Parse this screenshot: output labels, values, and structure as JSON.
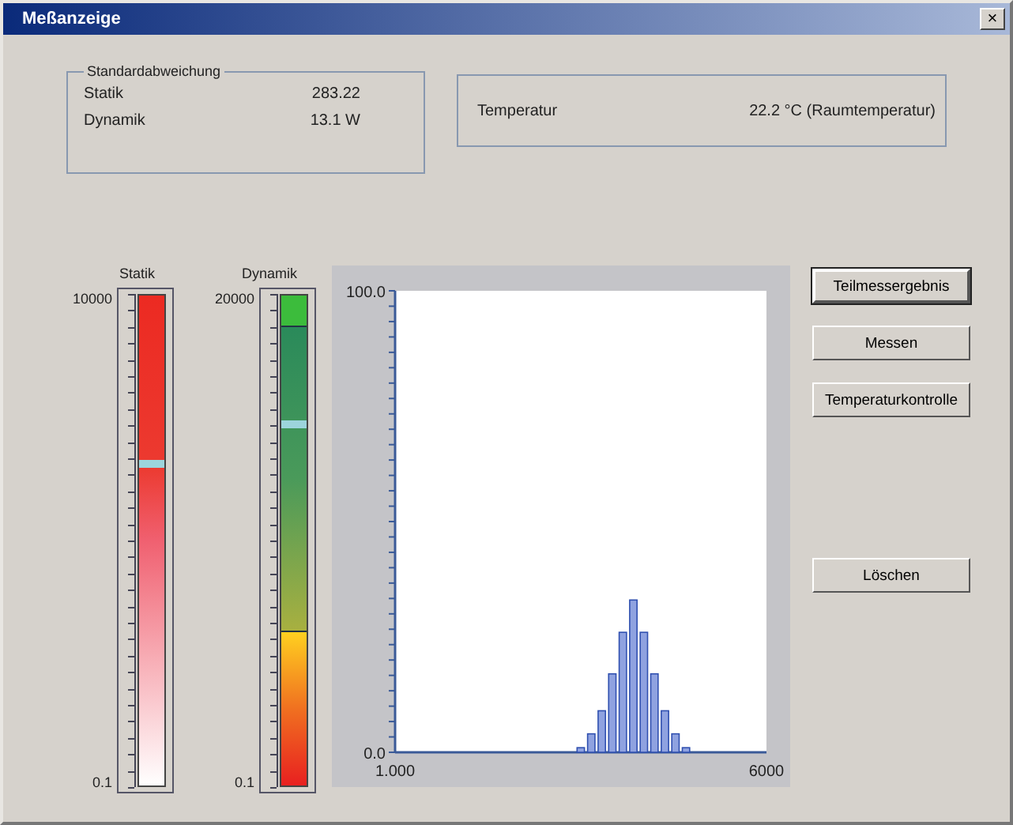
{
  "window": {
    "title": "Meßanzeige",
    "close": "×"
  },
  "standard_group": {
    "title": "Standardabweichung",
    "rows": [
      {
        "label": "Statik",
        "value": "283.22"
      },
      {
        "label": "Dynamik",
        "value": "13.1 W"
      }
    ]
  },
  "temperature": {
    "label": "Temperatur",
    "value": "22.2 °C (Raumtemperatur)"
  },
  "meters": [
    {
      "label": "Statik",
      "kind": "gradient",
      "max": "10000",
      "min": "0.1",
      "level": 0.65
    },
    {
      "label": "Dynamik",
      "kind": "zones",
      "max": "20000",
      "min": "0.1",
      "level": 0.73
    }
  ],
  "histogram": {
    "chart_data": {
      "type": "bar",
      "x": [
        3000,
        3170,
        3340,
        3510,
        3680,
        3850,
        4020,
        4190,
        4360,
        4530,
        4700
      ],
      "values": [
        1,
        4,
        9,
        17,
        26,
        33,
        26,
        17,
        9,
        4,
        1
      ],
      "xlim": [
        1,
        6000
      ],
      "ylim": [
        0,
        100
      ],
      "xticks": [
        {
          "value": 1,
          "label": "1.000"
        },
        {
          "value": 6000,
          "label": "6000"
        }
      ],
      "yticks": [
        {
          "value": 0,
          "label": "0.0"
        },
        {
          "value": 100,
          "label": "100.0"
        }
      ]
    }
  },
  "buttons": [
    {
      "label": "Teilmessergebnis",
      "default": true
    },
    {
      "label": "Messen",
      "default": false
    },
    {
      "label": "Temperaturkontrolle",
      "default": false
    },
    {
      "label": "Löschen",
      "default": false
    }
  ]
}
